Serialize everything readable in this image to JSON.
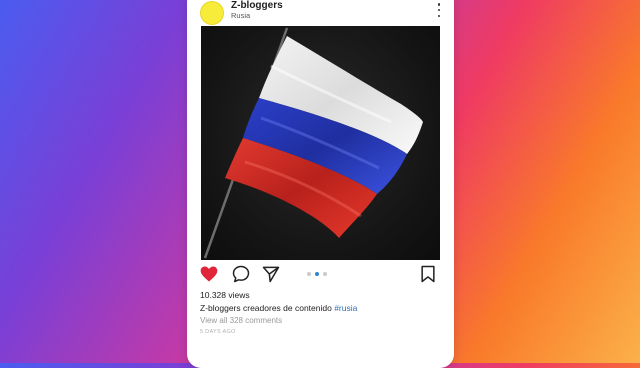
{
  "post": {
    "username": "Z-bloggers",
    "location": "Rusia",
    "views": "10.328 views",
    "caption_user": "Z-bloggers",
    "caption_text": " creadores de contenido ",
    "hashtag": "#rusia",
    "comments_link": "View all 328 comments",
    "time_ago": "5 DAYS AGO",
    "liked": true,
    "carousel": {
      "total": 3,
      "active": 2
    }
  },
  "colors": {
    "like": "#e0243a",
    "avatar": "#f7ec3a",
    "hashtag": "#2f6fb2",
    "carousel_active": "#2f86d4"
  },
  "icons": [
    "more-options-icon",
    "heart-icon",
    "comment-icon",
    "share-icon",
    "bookmark-icon"
  ]
}
